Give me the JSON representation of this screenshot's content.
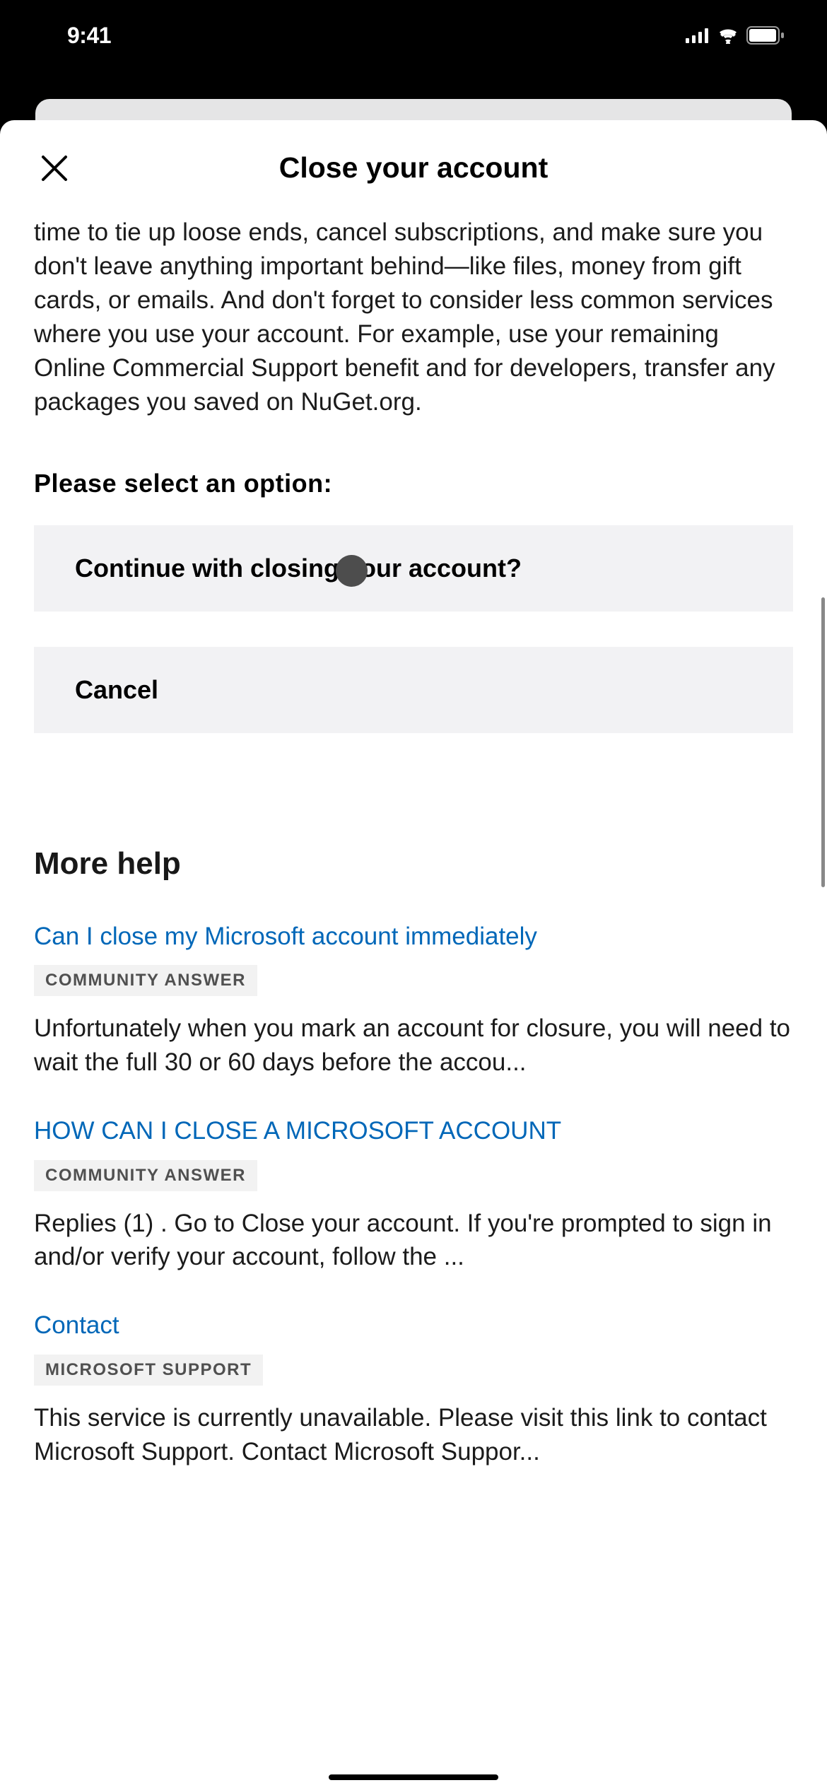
{
  "status": {
    "time": "9:41"
  },
  "header": {
    "title": "Close your account"
  },
  "body": {
    "paragraph": "time to tie up loose ends, cancel subscriptions, and make sure you don't leave anything important behind—like files, money from gift cards, or emails. And don't forget to consider less common services where you use your account. For example, use your remaining Online Commercial Support benefit and for developers, transfer any packages you saved on NuGet.org.",
    "prompt": "Please select an option:",
    "options": {
      "continue": "Continue with closing your account?",
      "cancel": "Cancel"
    }
  },
  "moreHelp": {
    "title": "More help",
    "items": [
      {
        "link": "Can I close my Microsoft account immediately",
        "tag": "COMMUNITY ANSWER",
        "snippet": "Unfortunately when you mark an account for closure, you will need to wait the full 30 or 60 days before the accou..."
      },
      {
        "link": "HOW CAN I CLOSE A MICROSOFT ACCOUNT",
        "tag": "COMMUNITY ANSWER",
        "snippet": "Replies (1) . Go to Close your account. If you're prompted to sign in and/or verify your account, follow the ..."
      },
      {
        "link": "Contact",
        "tag": "MICROSOFT SUPPORT",
        "snippet": "This service is currently unavailable. Please visit this link to contact Microsoft Support. Contact Microsoft Suppor..."
      }
    ]
  }
}
